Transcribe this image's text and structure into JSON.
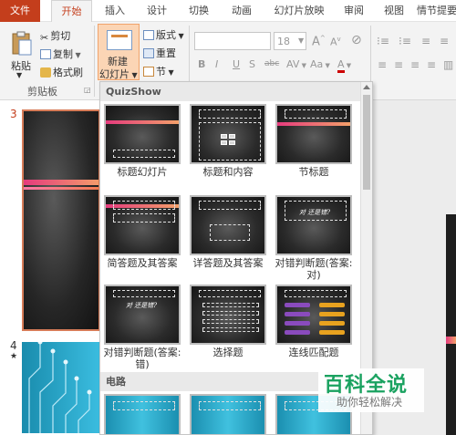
{
  "tabs": [
    "文件",
    "开始",
    "插入",
    "设计",
    "切换",
    "动画",
    "幻灯片放映",
    "审阅",
    "视图",
    "情节提要"
  ],
  "clipboard": {
    "paste": "粘贴",
    "cut": "剪切",
    "copy": "复制",
    "format_painter": "格式刷",
    "group_label": "剪贴板"
  },
  "slides_group": {
    "new_slide_line1": "新建",
    "new_slide_line2": "幻灯片",
    "layout": "版式",
    "reset": "重置",
    "section": "节"
  },
  "font": {
    "size": "18",
    "bold": "B",
    "italic": "I",
    "underline": "U",
    "strike": "S",
    "abc": "abc",
    "spacing": "AV",
    "case": "Aa",
    "grow": "A",
    "shrink": "A"
  },
  "panel": {
    "sections": [
      {
        "title": "QuizShow",
        "layouts": [
          "标题幻灯片",
          "标题和内容",
          "节标题",
          "简答题及其答案",
          "详答题及其答案",
          "对错判断题(答案:对)",
          "对错判断题(答案:错)",
          "选择题",
          "连线匹配题"
        ]
      },
      {
        "title": "电路"
      }
    ],
    "handwriting": [
      "对 还是错?",
      "对 还是错?"
    ]
  },
  "thumbnails": [
    {
      "number": "3"
    },
    {
      "number": "4",
      "star": "★"
    }
  ],
  "watermark": {
    "title": "百科全说",
    "subtitle": "助你轻松解决"
  },
  "colors": {
    "file_tab": "#c43e1c",
    "active_accent": "#c43e1c",
    "new_slide_bg": "#fbd5b5",
    "stripe": "#e53b7d",
    "watermark_green": "#1aa260"
  }
}
